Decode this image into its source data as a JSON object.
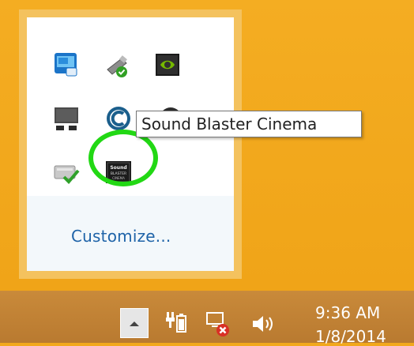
{
  "tray_overflow": {
    "icons": [
      {
        "name": "intel-graphics-icon"
      },
      {
        "name": "usb-safely-remove-icon"
      },
      {
        "name": "nvidia-icon"
      },
      {
        "name": "display-projector-icon"
      },
      {
        "name": "app-c-icon"
      },
      {
        "name": "webcam-icon"
      },
      {
        "name": "network-check-icon"
      },
      {
        "name": "sound-blaster-cinema-icon"
      }
    ],
    "customize_label": "Customize..."
  },
  "tooltip": {
    "text": "Sound Blaster Cinema"
  },
  "sound_blaster_icon_text": "Sound BLASTER CINEMA",
  "taskbar": {
    "clock_time": "9:36 AM",
    "clock_date": "1/8/2014",
    "icons": [
      "show-hidden-icons-icon",
      "power-icon",
      "network-disconnected-icon",
      "volume-icon"
    ]
  },
  "colors": {
    "desktop": "#f2a81c",
    "taskbar": "#c08236",
    "highlight": "#22d814",
    "link": "#1e63a8"
  }
}
